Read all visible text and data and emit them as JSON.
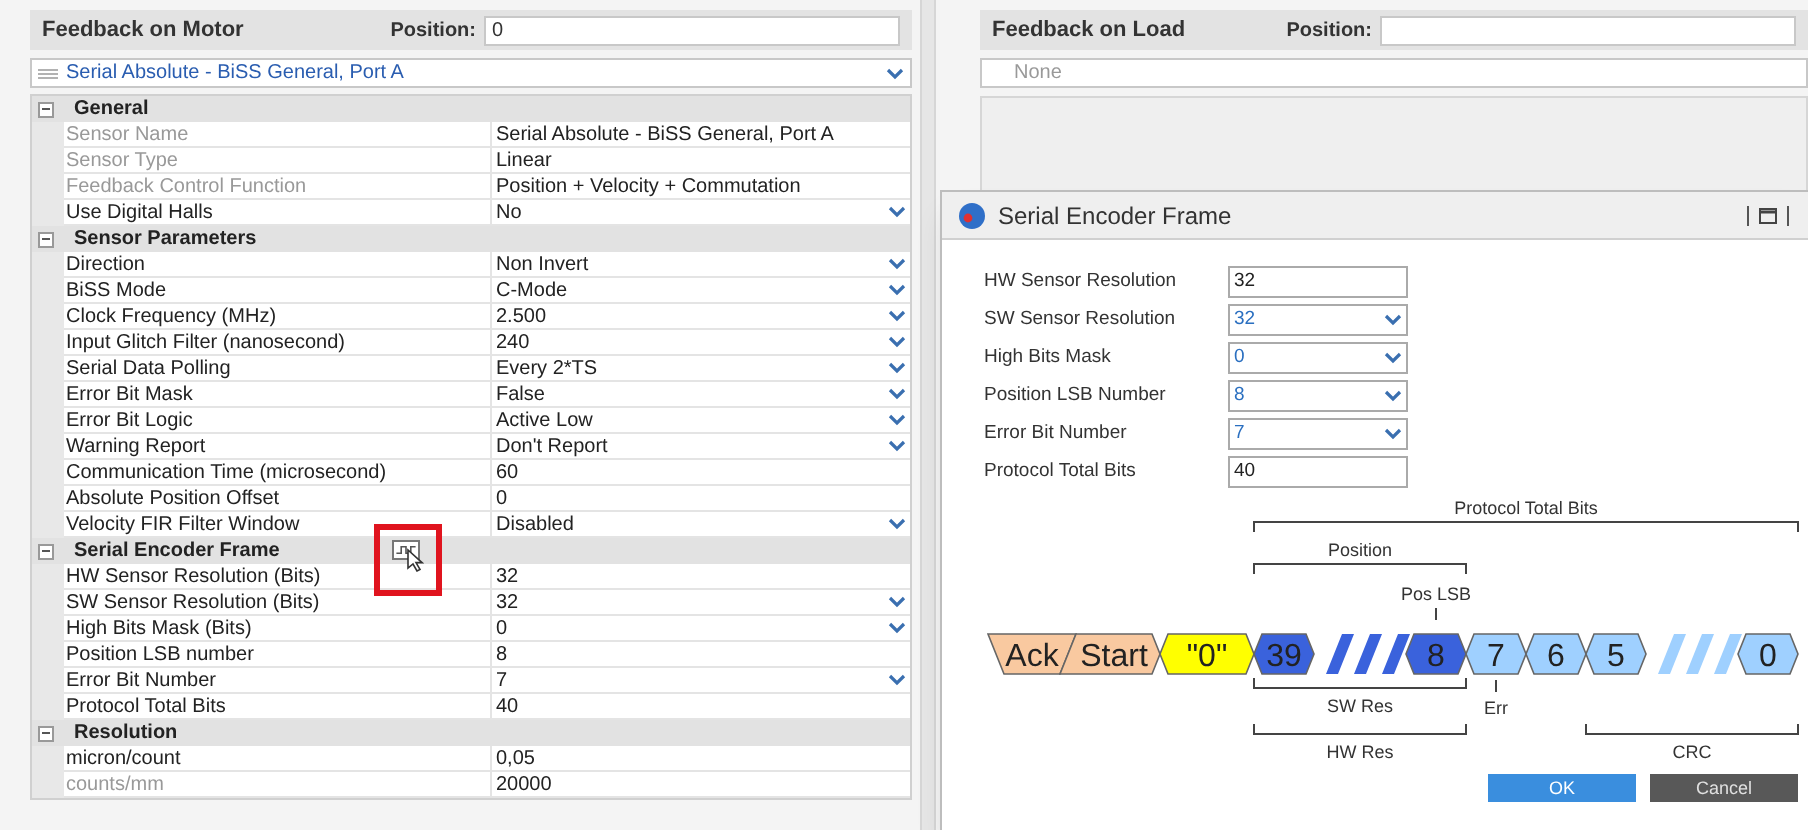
{
  "motor_feedback": {
    "title": "Feedback on Motor",
    "position_label": "Position:",
    "position_value": "0",
    "sensor_select": "Serial Absolute - BiSS General, Port A",
    "sections": [
      {
        "title": "General",
        "expanded": true,
        "annotated": false,
        "rows": [
          {
            "label": "Sensor Name",
            "value": "Serial Absolute - BiSS General, Port A",
            "kind": "readonly"
          },
          {
            "label": "Sensor Type",
            "value": "Linear",
            "kind": "readonly"
          },
          {
            "label": "Feedback Control Function",
            "value": "Position + Velocity + Commutation",
            "kind": "readonly"
          },
          {
            "label": "Use Digital Halls",
            "value": "No",
            "kind": "dropdown"
          }
        ]
      },
      {
        "title": "Sensor Parameters",
        "expanded": true,
        "annotated": false,
        "rows": [
          {
            "label": "Direction",
            "value": "Non Invert",
            "kind": "dropdown"
          },
          {
            "label": "BiSS Mode",
            "value": "C-Mode",
            "kind": "dropdown"
          },
          {
            "label": "Clock Frequency (MHz)",
            "value": "2.500",
            "kind": "dropdown"
          },
          {
            "label": "Input Glitch Filter (nanosecond)",
            "value": "240",
            "kind": "dropdown"
          },
          {
            "label": "Serial Data Polling",
            "value": "Every 2*TS",
            "kind": "dropdown"
          },
          {
            "label": "Error Bit Mask",
            "value": "False",
            "kind": "dropdown"
          },
          {
            "label": "Error Bit Logic",
            "value": "Active Low",
            "kind": "dropdown"
          },
          {
            "label": "Warning Report",
            "value": "Don't Report",
            "kind": "dropdown"
          },
          {
            "label": "Communication Time (microsecond)",
            "value": "60",
            "kind": "text"
          },
          {
            "label": "Absolute Position Offset",
            "value": "0",
            "kind": "text"
          },
          {
            "label": "Velocity FIR Filter Window",
            "value": "Disabled",
            "kind": "dropdown"
          }
        ]
      },
      {
        "title": "Serial Encoder Frame",
        "expanded": true,
        "annotated": true,
        "rows": [
          {
            "label": "HW Sensor Resolution (Bits)",
            "value": "32",
            "kind": "text"
          },
          {
            "label": "SW Sensor Resolution (Bits)",
            "value": "32",
            "kind": "dropdown"
          },
          {
            "label": "High Bits Mask (Bits)",
            "value": "0",
            "kind": "dropdown"
          },
          {
            "label": "Position LSB number",
            "value": "8",
            "kind": "text"
          },
          {
            "label": "Error Bit Number",
            "value": "7",
            "kind": "dropdown"
          },
          {
            "label": "Protocol Total Bits",
            "value": "40",
            "kind": "text"
          }
        ]
      },
      {
        "title": "Resolution",
        "expanded": true,
        "annotated": false,
        "rows": [
          {
            "label": "micron/count",
            "value": "0,05",
            "kind": "text"
          },
          {
            "label": "counts/mm",
            "value": "20000",
            "kind": "readonly"
          }
        ]
      }
    ]
  },
  "load_feedback": {
    "title": "Feedback on Load",
    "position_label": "Position:",
    "sensor_select": "None"
  },
  "dialog": {
    "title": "Serial Encoder Frame",
    "fields": [
      {
        "label": "HW Sensor Resolution",
        "value": "32",
        "kind": "text"
      },
      {
        "label": "SW Sensor Resolution",
        "value": "32",
        "kind": "dropdown"
      },
      {
        "label": "High Bits Mask",
        "value": "0",
        "kind": "dropdown"
      },
      {
        "label": "Position LSB Number",
        "value": "8",
        "kind": "dropdown"
      },
      {
        "label": "Error Bit Number",
        "value": "7",
        "kind": "dropdown"
      },
      {
        "label": "Protocol Total Bits",
        "value": "40",
        "kind": "text"
      }
    ],
    "diagram": {
      "segments": [
        {
          "kind": "ack",
          "label": "Ack",
          "color": "#f9c9a0"
        },
        {
          "kind": "start",
          "label": "Start",
          "color": "#f9c9a0"
        },
        {
          "kind": "bit",
          "label": "\"0\"",
          "color": "#ffff00"
        },
        {
          "kind": "bit",
          "label": "39",
          "color": "#3a62dc"
        },
        {
          "kind": "gap",
          "color": "#3a62dc"
        },
        {
          "kind": "bit",
          "label": "8",
          "color": "#3a62dc"
        },
        {
          "kind": "bit",
          "label": "7",
          "color": "#9fd0ff"
        },
        {
          "kind": "bit",
          "label": "6",
          "color": "#9fd0ff"
        },
        {
          "kind": "bit",
          "label": "5",
          "color": "#9fd0ff"
        },
        {
          "kind": "gap",
          "color": "#9fd0ff"
        },
        {
          "kind": "bit",
          "label": "0",
          "color": "#9fd0ff"
        }
      ],
      "brackets": [
        {
          "label": "Protocol Total Bits"
        },
        {
          "label": "Position"
        },
        {
          "label": "SW Res"
        },
        {
          "label": "HW Res"
        },
        {
          "label": "CRC"
        }
      ],
      "markers": [
        {
          "label": "Pos LSB"
        },
        {
          "label": "Err"
        }
      ]
    },
    "buttons": [
      {
        "label": "OK",
        "kind": "primary"
      },
      {
        "label": "Cancel",
        "kind": "secondary"
      }
    ]
  }
}
